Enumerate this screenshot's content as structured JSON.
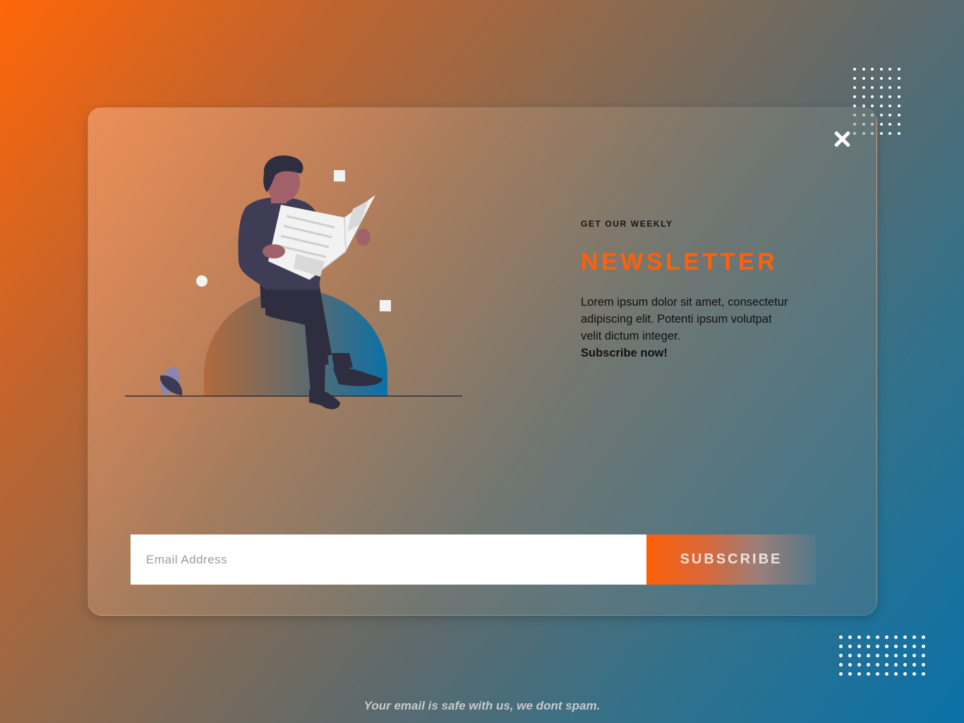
{
  "popup": {
    "kicker": "GET OUR WEEKLY",
    "headline": "NEWSLETTER",
    "description": "Lorem ipsum dolor sit amet, consectetur adipiscing elit. Potenti ipsum volutpat velit dictum integer.",
    "cta": "Subscribe now!",
    "close_icon": "close-icon"
  },
  "form": {
    "email_placeholder": "Email Address",
    "email_value": "",
    "subscribe_label": "SUBSCRIBE"
  },
  "footer": {
    "note": "Your email is safe with us, we dont spam."
  },
  "colors": {
    "accent": "#ff6008",
    "background_start": "#ff6608",
    "background_end": "#0a71a8"
  }
}
